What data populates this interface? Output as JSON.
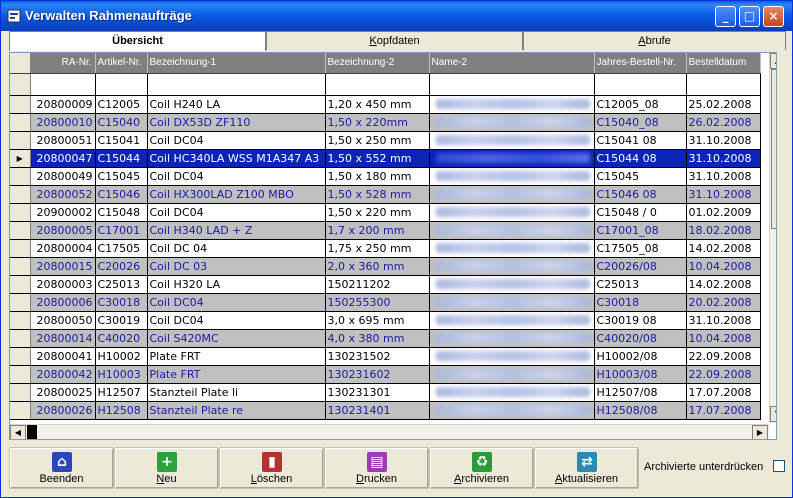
{
  "window": {
    "title": "Verwalten Rahmenaufträge"
  },
  "titlebar_buttons": {
    "minimize": "_",
    "maximize": "□",
    "close": "×"
  },
  "tabs": [
    {
      "label": "Übersicht",
      "mnemonic": "",
      "rest": ""
    },
    {
      "label": "",
      "mnemonic": "K",
      "rest": "opfdaten"
    },
    {
      "label": "",
      "mnemonic": "A",
      "rest": "brufe"
    }
  ],
  "grid": {
    "columns": [
      "RA-Nr.",
      "Artikel-Nr.",
      "Bezeichnung-1",
      "Bezeichnung-2",
      "Name-2",
      "Jahres-Bestell-Nr.",
      "Bestelldatum"
    ],
    "rows": [
      [
        "20800009",
        "C12005",
        "Coil  H240 LA",
        "1,20 x 450 mm",
        "C12005_08",
        "25.02.2008"
      ],
      [
        "20800010",
        "C15040",
        "Coil DX53D ZF110",
        "1,50 x 220mm",
        "C15040_08",
        "26.02.2008"
      ],
      [
        "20800051",
        "C15041",
        "Coil DC04",
        "1,50 x 250 mm",
        "C15041 08",
        "31.10.2008"
      ],
      [
        "20800047",
        "C15044",
        "Coil HC340LA WSS M1A347 A3",
        "1,50 x 552 mm",
        "C15044 08",
        "31.10.2008"
      ],
      [
        "20800049",
        "C15045",
        "Coil DC04",
        "1,50 x 180 mm",
        "C15045",
        "31.10.2008"
      ],
      [
        "20800052",
        "C15046",
        "Coil  HX300LAD Z100 MBO",
        "1,50 x 528 mm",
        "C15046 08",
        "31.10.2008"
      ],
      [
        "20900002",
        "C15048",
        "Coil DC04",
        "1,50 x 220 mm",
        "C15048 / 0",
        "01.02.2009"
      ],
      [
        "20800005",
        "C17001",
        "Coil H340 LAD + Z",
        "1,7 x 200 mm",
        "C17001_08",
        "18.02.2008"
      ],
      [
        "20800004",
        "C17505",
        "Coil  DC 04",
        "1,75 x 250 mm",
        "C17505_08",
        "14.02.2008"
      ],
      [
        "20800015",
        "C20026",
        "Coil DC 03",
        "2,0 x 360 mm",
        "C20026/08",
        "10.04.2008"
      ],
      [
        "20800003",
        "C25013",
        "Coil H320 LA",
        "150211202",
        "C25013",
        "14.02.2008"
      ],
      [
        "20800006",
        "C30018",
        "Coil DC04",
        "150255300",
        "C30018",
        "20.02.2008"
      ],
      [
        "20800050",
        "C30019",
        "Coil DC04",
        "3,0 x 695 mm",
        "C30019 08",
        "31.10.2008"
      ],
      [
        "20800014",
        "C40020",
        "Coil S420MC",
        "4,0 x 380 mm",
        "C40020/08",
        "10.04.2008"
      ],
      [
        "20800041",
        "H10002",
        "Plate FRT",
        "130231502",
        "H10002/08",
        "22.09.2008"
      ],
      [
        "20800042",
        "H10003",
        "Plate FRT",
        "130231602",
        "H10003/08",
        "22.09.2008"
      ],
      [
        "20800025",
        "H12507",
        "Stanzteil Plate li",
        "130231301",
        "H12507/08",
        "17.07.2008"
      ],
      [
        "20800026",
        "H12508",
        "Stanzteil Plate re",
        "130231401",
        "H12508/08",
        "17.07.2008"
      ]
    ],
    "selected_row": 3,
    "row_indicator": "▶"
  },
  "scrollbar": {
    "up": "▲",
    "down": "▼",
    "left": "◀",
    "right": "▶"
  },
  "toolbar": {
    "buttons": [
      {
        "icon": "⌂",
        "pre": "",
        "mnemonic": "",
        "post": "Beenden",
        "color": "#2a48b8"
      },
      {
        "icon": "+",
        "pre": "",
        "mnemonic": "N",
        "post": "eu",
        "color": "#2aa43a"
      },
      {
        "icon": "▮",
        "pre": "",
        "mnemonic": "L",
        "post": "öschen",
        "color": "#b4332e"
      },
      {
        "icon": "▤",
        "pre": "",
        "mnemonic": "D",
        "post": "rucken",
        "color": "#a03ab8"
      },
      {
        "icon": "♻",
        "pre": "",
        "mnemonic": "A",
        "post": "rchivieren",
        "color": "#2a9a3a"
      },
      {
        "icon": "⇄",
        "pre": "",
        "mnemonic": "A",
        "post": "ktualisieren",
        "color": "#2a8ab4"
      }
    ],
    "checkbox_label": "Archivierte unterdrücken"
  }
}
